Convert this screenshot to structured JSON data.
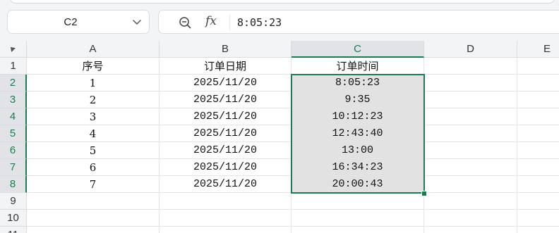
{
  "name_box": {
    "value": "C2"
  },
  "formula_bar": {
    "fx_label": "fx",
    "formula": "8:05:23"
  },
  "columns": [
    "A",
    "B",
    "C",
    "D",
    "E"
  ],
  "rows": [
    "1",
    "2",
    "3",
    "4",
    "5",
    "6",
    "7",
    "8",
    "9",
    "10",
    "11"
  ],
  "sheet": {
    "headers": [
      "序号",
      "订单日期",
      "订单时间"
    ],
    "data": [
      [
        "1",
        "2025/11/20",
        "8:05:23"
      ],
      [
        "2",
        "2025/11/20",
        "9:35"
      ],
      [
        "3",
        "2025/11/20",
        "10:12:23"
      ],
      [
        "4",
        "2025/11/20",
        "12:43:40"
      ],
      [
        "5",
        "2025/11/20",
        "13:00"
      ],
      [
        "6",
        "2025/11/20",
        "16:34:23"
      ],
      [
        "7",
        "2025/11/20",
        "20:00:43"
      ]
    ]
  },
  "colors": {
    "accent": "#1d7b53",
    "selection_fill": "#e2e2e2",
    "header_bg": "#f3f4f6"
  }
}
